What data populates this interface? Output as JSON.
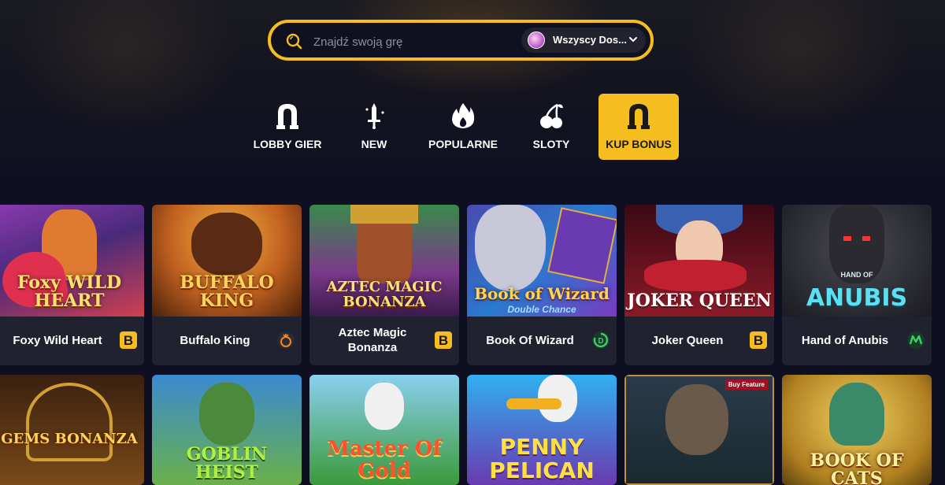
{
  "search": {
    "placeholder": "Znajdź swoją grę",
    "provider_label": "Wszyscy Dos..."
  },
  "categories": [
    {
      "label": "LOBBY GIER",
      "icon": "arch-icon",
      "active": false
    },
    {
      "label": "NEW",
      "icon": "sword-icon",
      "active": false
    },
    {
      "label": "POPULARNE",
      "icon": "flame-icon",
      "active": false
    },
    {
      "label": "SLOTY",
      "icon": "cherries-icon",
      "active": false
    },
    {
      "label": "KUP BONUS",
      "icon": "arch-icon",
      "active": true
    }
  ],
  "games_row1": [
    {
      "name": "Foxy Wild Heart",
      "thumb_text": "Foxy WILD HEART",
      "provider_icon": "bgaming-icon",
      "colors": [
        "#6a2a8a",
        "#e04040"
      ]
    },
    {
      "name": "Buffalo King",
      "thumb_text": "BUFFALO KING",
      "provider_icon": "pragmatic-icon",
      "colors": [
        "#d87a20",
        "#5a2a10"
      ]
    },
    {
      "name": "Aztec Magic Bonanza",
      "thumb_text": "AZTEC MAGIC BONANZA",
      "provider_icon": "bgaming-icon",
      "colors": [
        "#2a6a3a",
        "#6a2a6a"
      ]
    },
    {
      "name": "Book Of Wizard",
      "thumb_text": "Book of Wizard",
      "thumb_sub": "Double Chance",
      "provider_icon": "spin-icon",
      "colors": [
        "#3a3a8a",
        "#2a8ad0"
      ]
    },
    {
      "name": "Joker Queen",
      "thumb_text": "JOKER QUEEN",
      "provider_icon": "bgaming-icon",
      "colors": [
        "#8a1020",
        "#2a0a10"
      ]
    },
    {
      "name": "Hand of Anubis",
      "thumb_text": "ANUBIS",
      "thumb_sub": "HAND OF",
      "provider_icon": "microgaming-icon",
      "colors": [
        "#2a2a30",
        "#4a4a55"
      ]
    }
  ],
  "games_row2": [
    {
      "thumb_text": "GEMS BONANZA",
      "colors": [
        "#3a2010",
        "#6a4020"
      ]
    },
    {
      "thumb_text": "GOBLIN HEIST",
      "colors": [
        "#2a6aaa",
        "#4aaa4a"
      ]
    },
    {
      "thumb_text": "Master Of Gold",
      "colors": [
        "#3a9a3a",
        "#8ac8e0"
      ]
    },
    {
      "thumb_text": "PENNY PELICAN",
      "colors": [
        "#2aa0e0",
        "#5a3aa0"
      ]
    },
    {
      "thumb_text": "Buy Feature",
      "colors": [
        "#1a2a3a",
        "#3a4a50"
      ]
    },
    {
      "thumb_text": "BOOK OF CATS",
      "colors": [
        "#c09020",
        "#6a4a10"
      ]
    }
  ],
  "theme": {
    "accent": "#f5be1e",
    "background": "#0e1022",
    "card": "#20222f"
  }
}
